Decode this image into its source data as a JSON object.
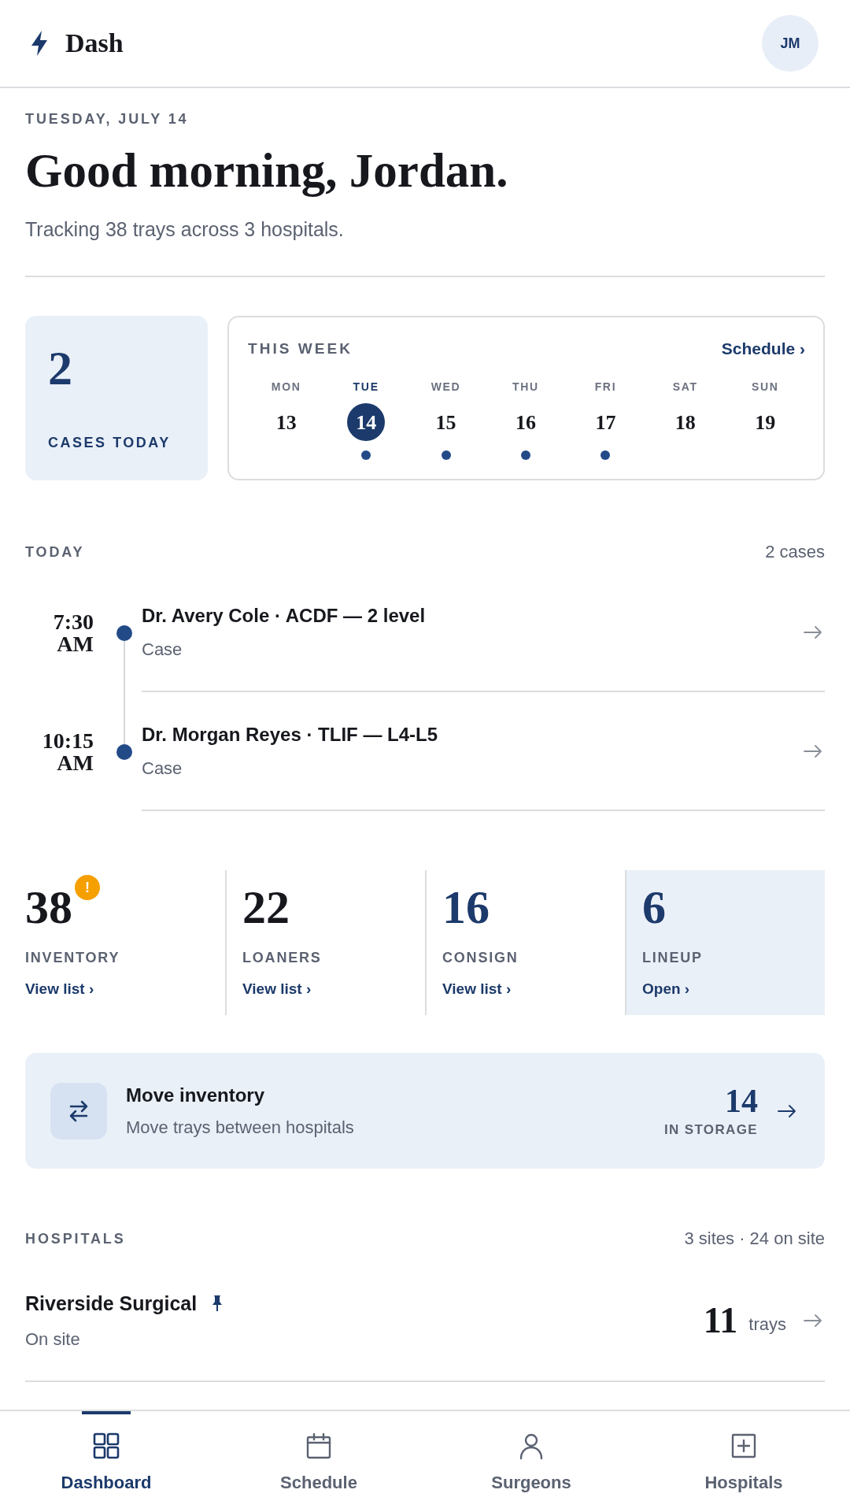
{
  "app_bar": {
    "brand": "Dash",
    "avatar_initials": "JM"
  },
  "greeting": {
    "date": "TUESDAY, JULY 14",
    "title": "Good morning, Jordan.",
    "subtitle": "Tracking 38 trays across 3 hospitals."
  },
  "cases_today": {
    "count": "2",
    "label": "CASES TODAY"
  },
  "week": {
    "title": "THIS WEEK",
    "link": "Schedule ›",
    "days": [
      {
        "weekday": "MON",
        "date": "13",
        "selected": false,
        "has_case": false
      },
      {
        "weekday": "TUE",
        "date": "14",
        "selected": true,
        "has_case": true
      },
      {
        "weekday": "WED",
        "date": "15",
        "selected": false,
        "has_case": true
      },
      {
        "weekday": "THU",
        "date": "16",
        "selected": false,
        "has_case": true
      },
      {
        "weekday": "FRI",
        "date": "17",
        "selected": false,
        "has_case": true
      },
      {
        "weekday": "SAT",
        "date": "18",
        "selected": false,
        "has_case": false
      },
      {
        "weekday": "SUN",
        "date": "19",
        "selected": false,
        "has_case": false
      }
    ]
  },
  "today": {
    "title": "TODAY",
    "count": "2 cases",
    "cases": [
      {
        "time": "7:30 AM",
        "title": "Dr. Avery Cole · ACDF — 2 level",
        "subtitle": "Case"
      },
      {
        "time": "10:15 AM",
        "title": "Dr. Morgan Reyes · TLIF — L4-L5",
        "subtitle": "Case"
      }
    ]
  },
  "stats": [
    {
      "value": "38",
      "badge": "!",
      "label": "INVENTORY",
      "link": "View list ›",
      "accent": false,
      "highlighted": false
    },
    {
      "value": "22",
      "label": "LOANERS",
      "link": "View list ›",
      "accent": false,
      "highlighted": false
    },
    {
      "value": "16",
      "label": "CONSIGN",
      "link": "View list ›",
      "accent": true,
      "highlighted": false
    },
    {
      "value": "6",
      "label": "LINEUP",
      "link": "Open ›",
      "accent": true,
      "highlighted": true
    }
  ],
  "move_inventory": {
    "title": "Move inventory",
    "subtitle": "Move trays between hospitals",
    "count": "14",
    "count_label": "IN STORAGE"
  },
  "hospitals": {
    "title": "HOSPITALS",
    "summary": "3 sites · 24 on site",
    "items": [
      {
        "name": "Riverside Surgical",
        "pinned": true,
        "status": "On site",
        "trays": "11",
        "unit": "trays"
      }
    ]
  },
  "bottom_nav": [
    {
      "label": "Dashboard",
      "selected": true
    },
    {
      "label": "Schedule",
      "selected": false
    },
    {
      "label": "Surgeons",
      "selected": false
    },
    {
      "label": "Hospitals",
      "selected": false
    }
  ]
}
